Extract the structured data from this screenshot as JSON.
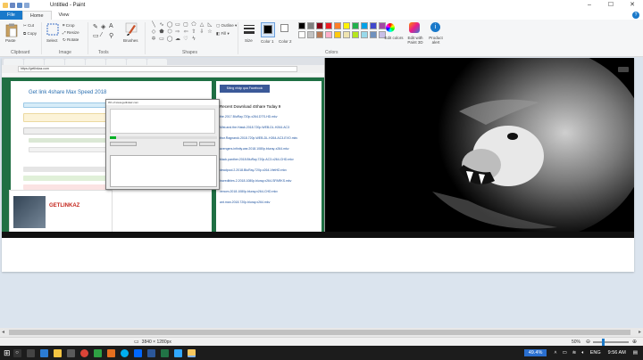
{
  "window": {
    "title": "Untitled - Paint",
    "controls": [
      "–",
      "☐",
      "✕"
    ]
  },
  "tabs": {
    "file": "File",
    "home": "Home",
    "view": "View"
  },
  "ribbon": {
    "clipboard": {
      "label": "Clipboard",
      "paste": "Paste",
      "cut": "Cut",
      "copy": "Copy"
    },
    "image": {
      "label": "Image",
      "select": "Select",
      "crop": "Crop",
      "resize": "Resize",
      "rotate": "Rotate"
    },
    "tools": {
      "label": "Tools"
    },
    "brushes": {
      "label": "Brushes"
    },
    "shapes": {
      "label": "Shapes",
      "outline": "Outline",
      "fill": "Fill"
    },
    "size": {
      "label": "Size"
    },
    "colors": {
      "label": "Colors",
      "color1": "Color 1",
      "color2": "Color 2",
      "edit_colors": "Edit colors",
      "edit_paint3d": "Edit with Paint 3D",
      "product_alert": "Product alert",
      "palette": [
        "#000000",
        "#7f7f7f",
        "#880015",
        "#ed1c24",
        "#ff7f27",
        "#fff200",
        "#22b14c",
        "#00a2e8",
        "#3f48cc",
        "#a349a4",
        "#ffffff",
        "#c3c3c3",
        "#b97a57",
        "#ffaec9",
        "#ffc90e",
        "#efe4b0",
        "#b5e61d",
        "#99d9ea",
        "#7092be",
        "#c8bfe7"
      ]
    }
  },
  "browser": {
    "url": "https://getlinkaz.com",
    "post_title": "Get link 4share Max Speed 2018",
    "facebook_button": "Đăng nhập qua Facebook",
    "sidebar_title": "Recent Download 4Share Today 9",
    "sidebar_links": [
      "the.2017.BluRay.720p.x264.DTS-HD.mkv",
      "Mist.and.the.Hawk.2018.720p.WEB-DL.H264.AC3",
      "thor.Ragnarok.2018.720p.WEB-DL.H264.AC3-EVO.mkv",
      "avengers.infinity.war.2018.1080p.bluray-x264.mkv",
      "black.panther.2018.BluRay.720p.AC3.x264-CHD.mkv",
      "deadpool.2.2018.BluRay.720p.x264-VietHD.mkv",
      "incredibles.2.2018.1080p.bluray.x264-SPARKS.mkv",
      "venom.2018.1080p.bluray.x264-CHD.mkv",
      "ant.man.2018.720p.bluray.x264.mkv"
    ],
    "promo_text": "GETLINKAZ"
  },
  "download_dialog": {
    "title": "0% of www.getlinkaz.com",
    "progress": 0.06
  },
  "status": {
    "dimensions": "3840 × 1280px",
    "zoom": "50%"
  },
  "taskbar": {
    "battery": "49.4%",
    "language": "ENG",
    "time": "9:56 AM"
  }
}
